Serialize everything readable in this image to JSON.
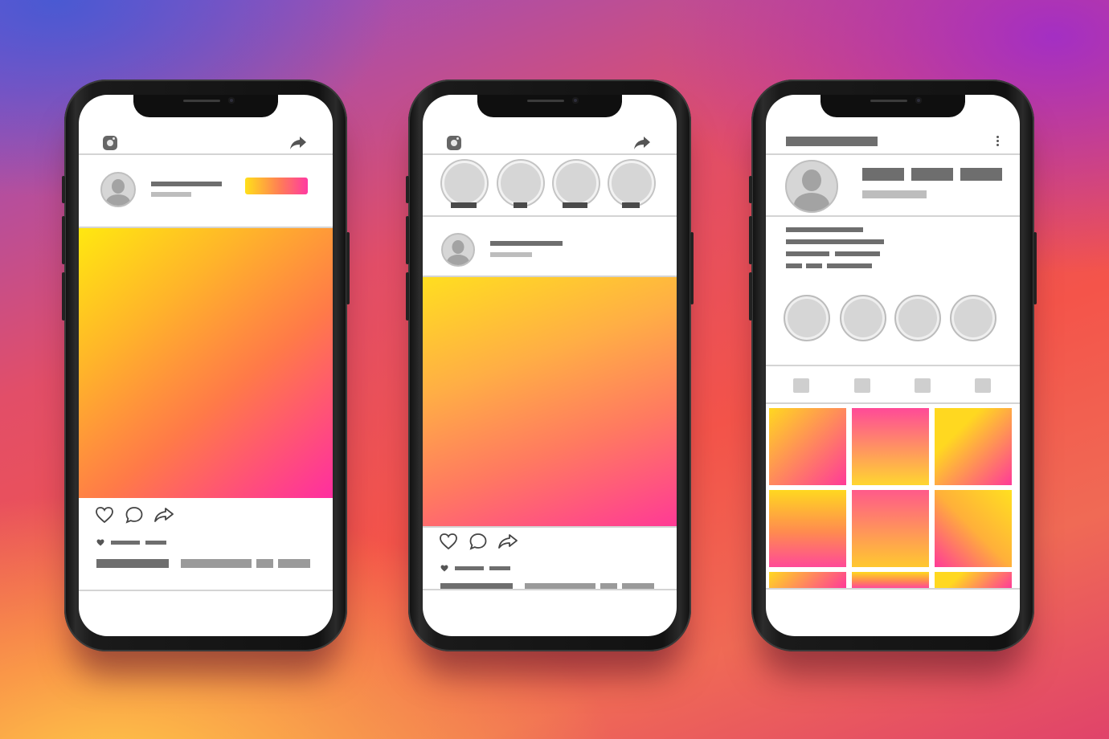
{
  "colors": {
    "screen_bg": "#ffffff",
    "placeholder_dark": "#6e6e6e",
    "placeholder_light": "#bdbdbd",
    "divider": "#d4d4d4",
    "gradient_start": "#ffe810",
    "gradient_end": "#ff2ea0"
  },
  "phones": [
    {
      "name": "feed-post",
      "icons": [
        "instagram-logo-icon",
        "share-icon",
        "avatar-icon",
        "heart-icon",
        "comment-icon",
        "send-icon"
      ],
      "elements": [
        "follow-button",
        "post-image",
        "like-line",
        "caption-line"
      ]
    },
    {
      "name": "feed-with-stories",
      "story_count": 4,
      "icons": [
        "instagram-logo-icon",
        "share-icon",
        "avatar-icon",
        "heart-icon",
        "comment-icon",
        "send-icon"
      ],
      "elements": [
        "stories-row",
        "post-image",
        "like-line",
        "caption-line"
      ]
    },
    {
      "name": "profile",
      "highlight_count": 4,
      "grid_rows_visible": 3,
      "grid_columns": 3,
      "icons": [
        "more-options-icon",
        "avatar-icon"
      ],
      "elements": [
        "username-bar",
        "stats-row",
        "bio-lines",
        "highlights-row",
        "tab-bar",
        "post-grid"
      ]
    }
  ]
}
